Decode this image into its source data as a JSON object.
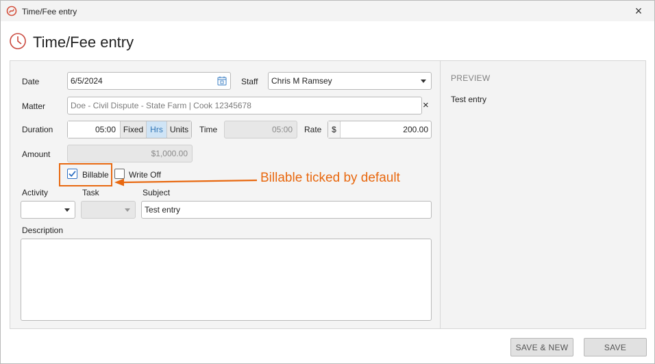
{
  "window": {
    "title": "Time/Fee entry",
    "close_glyph": "×"
  },
  "page": {
    "title": "Time/Fee entry"
  },
  "form": {
    "date": {
      "label": "Date",
      "value": "6/5/2024"
    },
    "staff": {
      "label": "Staff",
      "value": "Chris M Ramsey"
    },
    "matter": {
      "label": "Matter",
      "value": "Doe - Civil Dispute - State Farm | Cook 12345678",
      "clear_glyph": "×"
    },
    "duration": {
      "label": "Duration",
      "value": "05:00",
      "modes": [
        "Fixed",
        "Hrs",
        "Units"
      ],
      "selected_mode": "Hrs"
    },
    "time": {
      "label": "Time",
      "value": "05:00"
    },
    "rate": {
      "label": "Rate",
      "currency": "$",
      "value": "200.00"
    },
    "amount": {
      "label": "Amount",
      "value": "$1,000.00"
    },
    "billable": {
      "label": "Billable",
      "checked": true
    },
    "write_off": {
      "label": "Write Off",
      "checked": false
    },
    "activity": {
      "label": "Activity",
      "value": ""
    },
    "task": {
      "label": "Task",
      "value": ""
    },
    "subject": {
      "label": "Subject",
      "value": "Test entry"
    },
    "description": {
      "label": "Description",
      "value": ""
    }
  },
  "preview": {
    "title": "PREVIEW",
    "text": "Test entry"
  },
  "annotation": {
    "text": "Billable ticked by default",
    "color": "#e8680f"
  },
  "buttons": {
    "save_new": "SAVE & NEW",
    "save": "SAVE"
  },
  "icons": {
    "app": "app-logo-icon",
    "clock": "clock-icon",
    "calendar": "calendar-icon",
    "close": "close-icon",
    "clear": "clear-icon",
    "dropdown": "chevron-down-icon",
    "check": "checkmark-icon"
  }
}
